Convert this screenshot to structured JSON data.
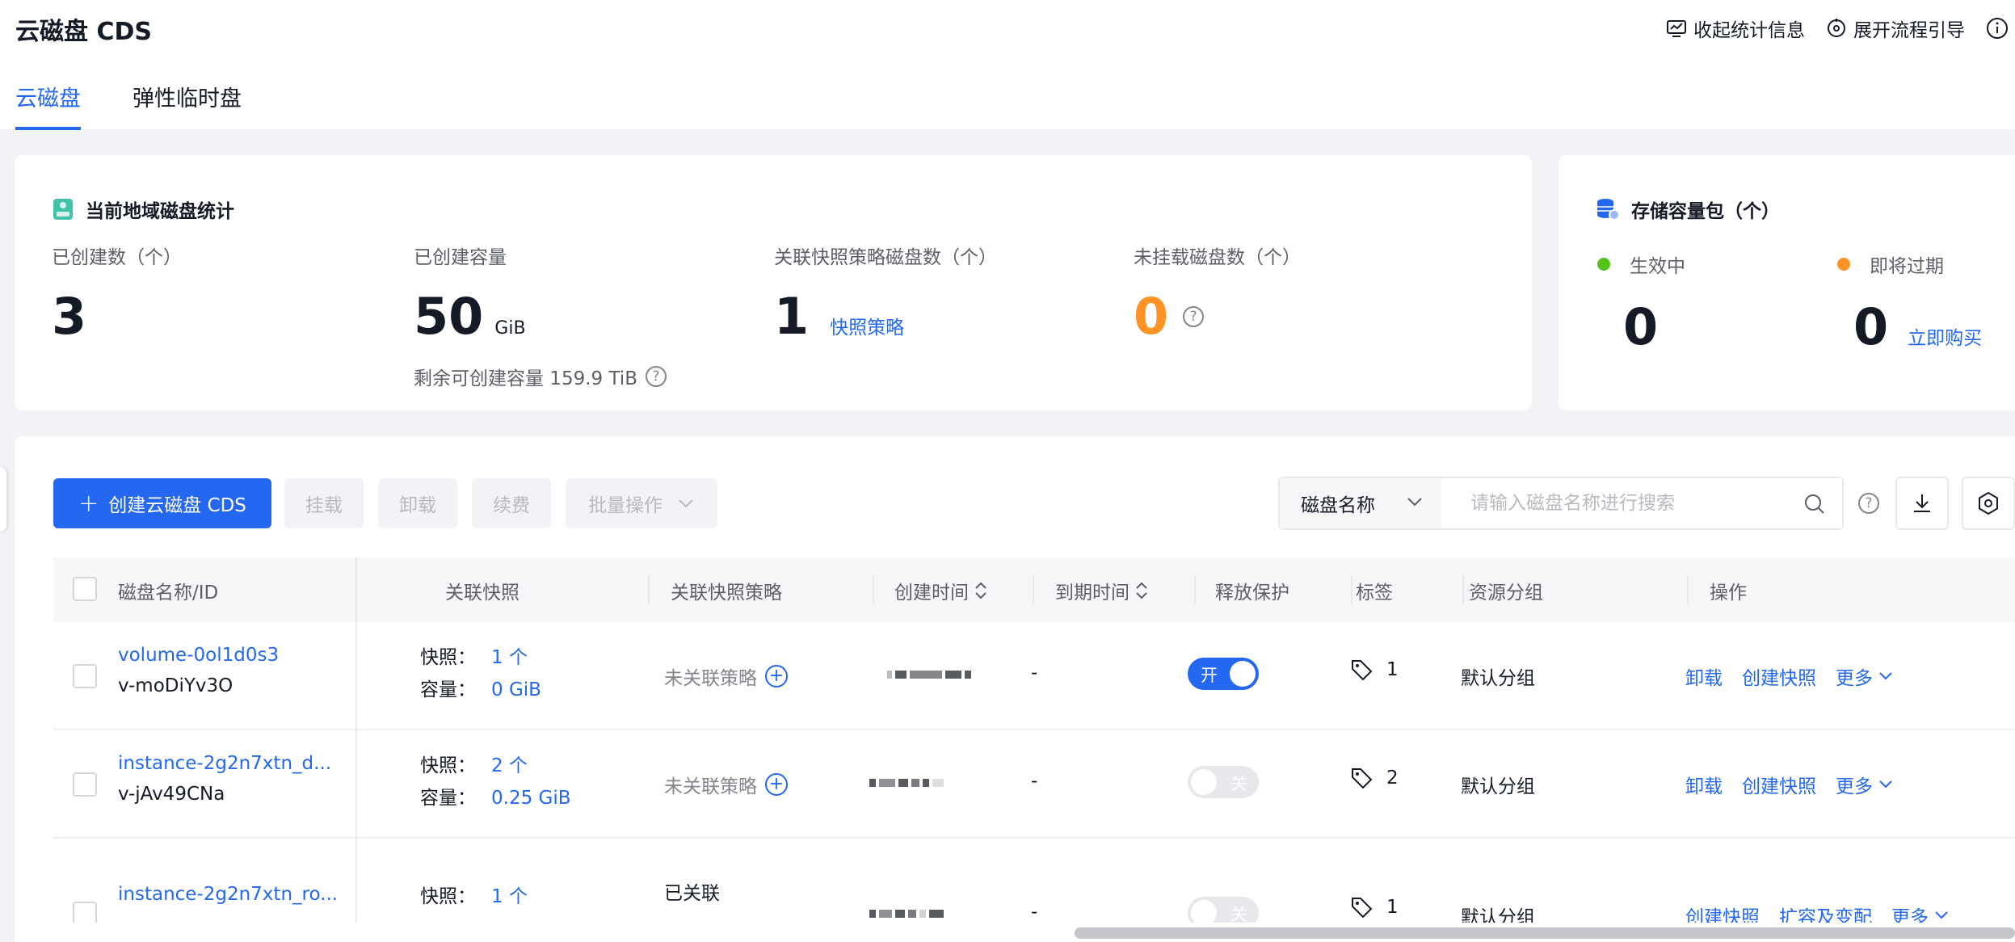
{
  "header": {
    "title": "云磁盘 CDS",
    "actions": [
      {
        "label": "收起统计信息",
        "icon": "monitor-icon"
      },
      {
        "label": "展开流程引导",
        "icon": "guide-icon"
      }
    ]
  },
  "tabs": [
    {
      "label": "云磁盘",
      "active": true
    },
    {
      "label": "弹性临时盘",
      "active": false
    }
  ],
  "stats": {
    "heading": "当前地域磁盘统计",
    "created_count": {
      "label": "已创建数（个）",
      "value": "3"
    },
    "created_capacity": {
      "label": "已创建容量",
      "value": "50",
      "unit": "GiB",
      "remaining": "剩余可创建容量 159.9 TiB"
    },
    "snapshot_policy_disks": {
      "label": "关联快照策略磁盘数（个）",
      "value": "1",
      "link": "快照策略"
    },
    "unmounted_disks": {
      "label": "未挂载磁盘数（个）",
      "value": "0"
    }
  },
  "pack": {
    "heading": "存储容量包（个）",
    "active": {
      "label": "生效中",
      "value": "0",
      "color": "#52c41a"
    },
    "expiring": {
      "label": "即将过期",
      "value": "0",
      "color": "#ff9326"
    },
    "buy_link": "立即购买"
  },
  "toolbar": {
    "create": "创建云磁盘 CDS",
    "mount": "挂载",
    "unmount": "卸载",
    "renew": "续费",
    "batch": "批量操作",
    "search_field": "磁盘名称",
    "search_placeholder": "请输入磁盘名称进行搜索"
  },
  "table": {
    "columns": {
      "name": "磁盘名称/ID",
      "snapshot": "关联快照",
      "policy": "关联快照策略",
      "created": "创建时间",
      "expire": "到期时间",
      "protect": "释放保护",
      "tags": "标签",
      "group": "资源分组",
      "ops": "操作"
    },
    "rows": [
      {
        "name": "volume-0ol1d0s3",
        "id": "v-moDiYv3O",
        "snap_key": "快照：",
        "snap_val": "1 个",
        "cap_key": "容量：",
        "cap_val": "0 GiB",
        "policy": "未关联策略",
        "expire": "-",
        "protect": "开",
        "tags": "1",
        "group": "默认分组",
        "ops": [
          "卸载",
          "创建快照",
          "更多"
        ]
      },
      {
        "name": "instance-2g2n7xtn_d...",
        "id": "v-jAv49CNa",
        "snap_key": "快照：",
        "snap_val": "2 个",
        "cap_key": "容量：",
        "cap_val": "0.25 GiB",
        "policy": "未关联策略",
        "expire": "-",
        "protect": "关",
        "tags": "2",
        "group": "默认分组",
        "ops": [
          "卸载",
          "创建快照",
          "更多"
        ]
      },
      {
        "name": "instance-2g2n7xtn_ro...",
        "id": "",
        "snap_key": "快照：",
        "snap_val": "1 个",
        "policy": "已关联",
        "expire": "-",
        "protect": "关",
        "tags": "1",
        "group": "默认分组",
        "ops": [
          "创建快照",
          "扩容及变配",
          "更多"
        ]
      }
    ]
  }
}
